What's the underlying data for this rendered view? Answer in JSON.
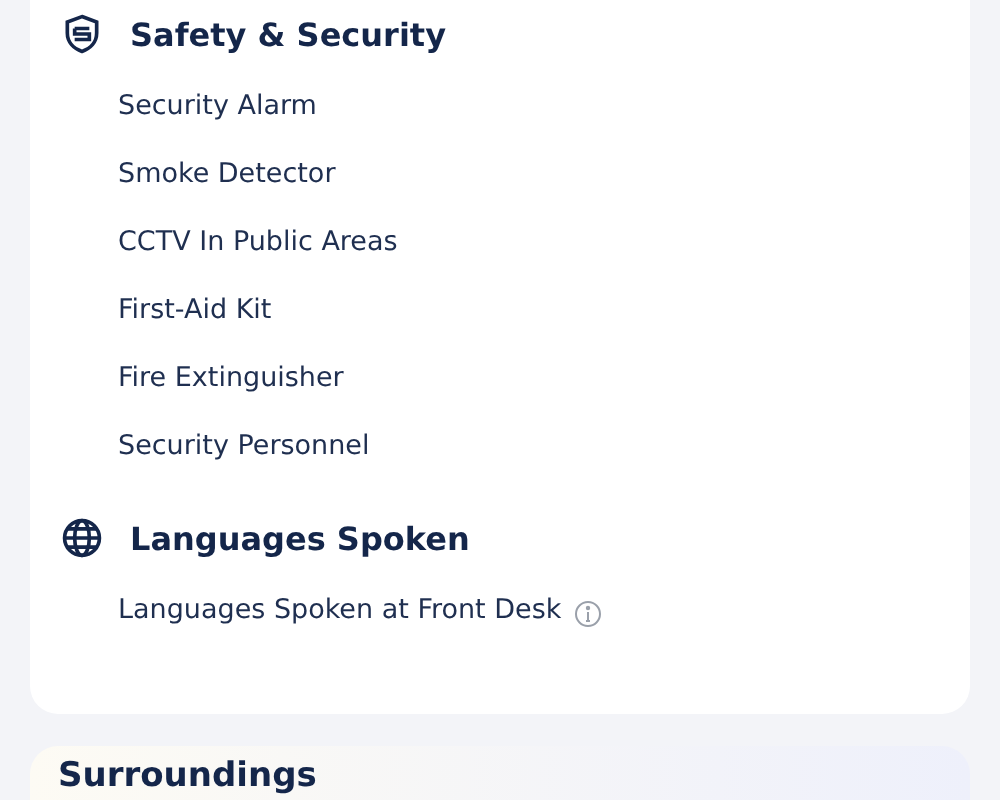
{
  "sections": [
    {
      "kind": "shield",
      "title": "Safety & Security",
      "items": [
        {
          "label": "Security Alarm"
        },
        {
          "label": "Smoke Detector"
        },
        {
          "label": "CCTV In Public Areas"
        },
        {
          "label": "First-Aid Kit"
        },
        {
          "label": "Fire Extinguisher"
        },
        {
          "label": "Security Personnel"
        }
      ]
    },
    {
      "kind": "globe",
      "title": "Languages Spoken",
      "items": [
        {
          "label": "Languages Spoken at Front Desk",
          "info": true
        }
      ]
    }
  ],
  "next_card": {
    "title": "Surroundings"
  }
}
